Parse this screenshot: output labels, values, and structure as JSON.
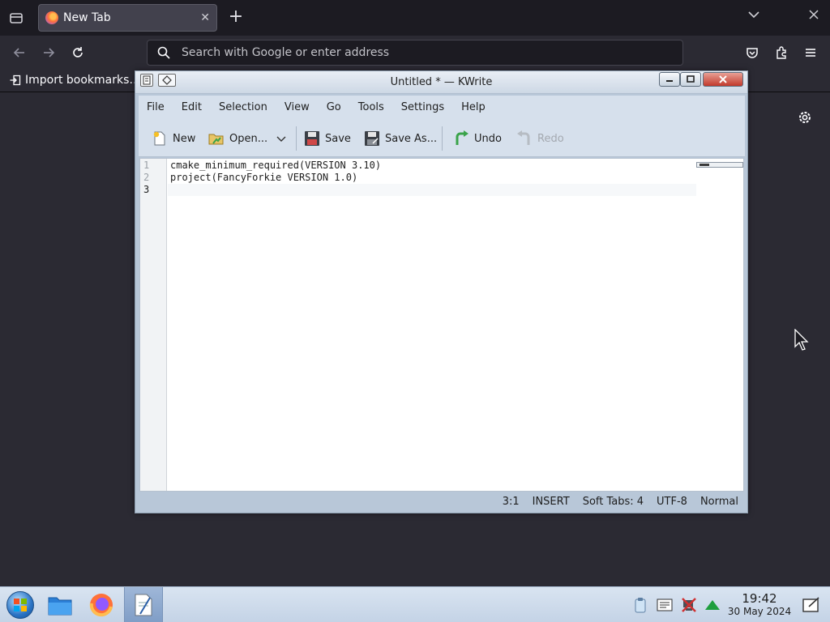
{
  "browser": {
    "tab_title": "New Tab",
    "tab_close": "✕",
    "new_tab": "+",
    "url_placeholder": "Search with Google or enter address",
    "bookmark": "Import bookmarks…"
  },
  "kwrite": {
    "title": "Untitled * — KWrite",
    "menu": [
      "File",
      "Edit",
      "Selection",
      "View",
      "Go",
      "Tools",
      "Settings",
      "Help"
    ],
    "toolbar": {
      "new": "New",
      "open": "Open...",
      "save": "Save",
      "save_as": "Save As...",
      "undo": "Undo",
      "redo": "Redo"
    },
    "line_numbers": [
      "1",
      "2",
      "3"
    ],
    "lines": [
      "cmake_minimum_required(VERSION 3.10)",
      "project(FancyForkie VERSION 1.0)",
      ""
    ],
    "status": {
      "cursor": "3:1",
      "mode": "INSERT",
      "indent": "Soft Tabs: 4",
      "encoding": "UTF-8",
      "input_mode": "Normal"
    }
  },
  "taskbar": {
    "time": "19:42",
    "date": "30 May 2024"
  },
  "colors": {
    "browser_bg": "#2b2a33",
    "kwrite_frame": "#b8c7d8",
    "close_red": "#c2392b"
  }
}
